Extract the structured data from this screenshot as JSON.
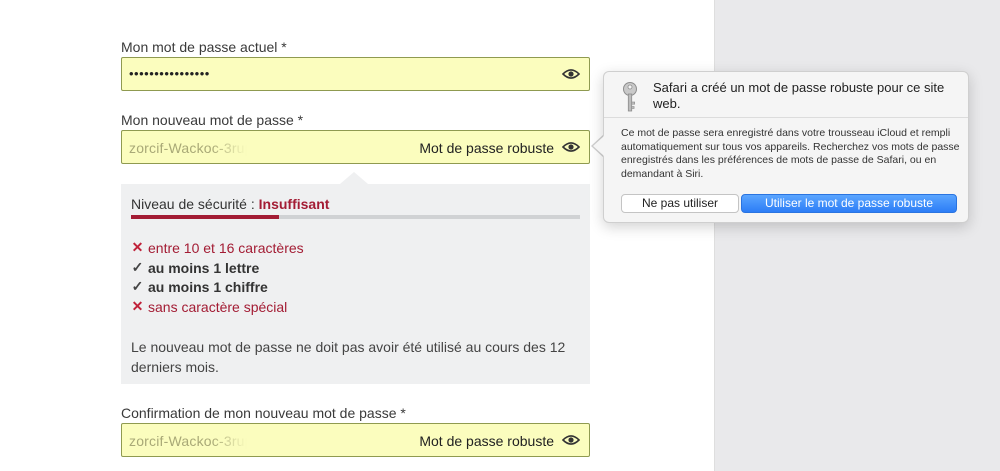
{
  "form": {
    "current_password": {
      "label": "Mon mot de passe actuel *",
      "masked_value": "••••••••••••••••"
    },
    "new_password": {
      "label": "Mon nouveau mot de passe *",
      "value": "zorcif-Wackoc-3rupt",
      "badge": "Mot de passe robuste"
    },
    "confirm_password": {
      "label": "Confirmation de mon nouveau mot de passe *",
      "value": "zorcif-Wackoc-3rupt",
      "badge": "Mot de passe robuste"
    }
  },
  "security": {
    "level_label": "Niveau de sécurité :",
    "level_value": "Insuffisant",
    "level_fraction": 0.33,
    "criteria": [
      {
        "text": "entre 10 et 16 caractères",
        "met": false
      },
      {
        "text": "au moins 1 lettre",
        "met": true
      },
      {
        "text": "au moins 1 chiffre",
        "met": true
      },
      {
        "text": "sans caractère spécial",
        "met": false
      }
    ],
    "note": "Le nouveau mot de passe ne doit pas avoir été utilisé au cours des 12 derniers mois."
  },
  "safari_popover": {
    "title": "Safari a créé un mot de passe robuste pour ce site web.",
    "body": "Ce mot de passe sera enregistré dans votre trousseau iCloud et rempli automatiquement sur tous vos appareils. Recherchez vos mots de passe enregistrés dans les préférences de mots de passe de Safari, ou en demandant à Siri.",
    "decline_label": "Ne pas utiliser",
    "accept_label": "Utiliser le mot de passe robuste"
  },
  "icons": {
    "eye": "eye-icon",
    "key": "key-icon",
    "fail": "cross-icon",
    "ok": "check-icon"
  },
  "colors": {
    "autofill_bg": "#fbfdbe",
    "danger": "#a31c34",
    "primary_button": "#2c7df6"
  }
}
